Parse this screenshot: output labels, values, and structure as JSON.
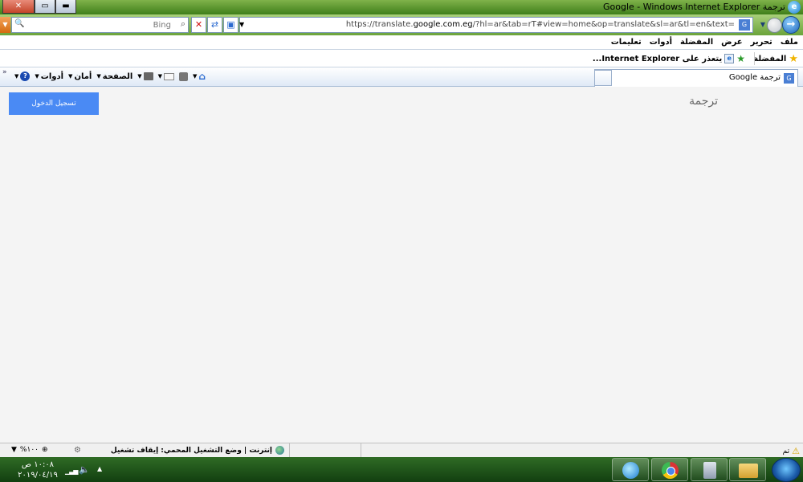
{
  "window": {
    "title": "ترجمة Google - Windows Internet Explorer",
    "buttons": {
      "minimize": "▬",
      "maximize": "▭",
      "close": "✕"
    }
  },
  "address_bar": {
    "url_prefix": "https://translate.",
    "url_domain": "google.com.eg",
    "url_suffix": "/?hl=ar&tab=rT#view=home&op=translate&sl=ar&tl=en&text=",
    "search_placeholder": "Bing"
  },
  "menu": [
    "ملف",
    "تحرير",
    "عرض",
    "المفضلة",
    "أدوات",
    "تعليمات"
  ],
  "favorites_bar": {
    "favorites_label": "المفضلة",
    "suggested_site": "يتعذر على Internet Explorer..."
  },
  "tab": {
    "title": "ترجمة Google"
  },
  "command_bar": {
    "page": "الصفحة",
    "safety": "أمان",
    "tools": "أدوات",
    "chevron": "»"
  },
  "content": {
    "signin_button": "تسجيل الدخول",
    "page_title": "ترجمة"
  },
  "status_bar": {
    "done": "تم",
    "zone": "إنترنت | وضع التشغيل المحمي: إيقاف تشغيل",
    "zoom": "%١٠٠"
  },
  "taskbar": {
    "time": "١٠:٠٨ ص",
    "date": "٢٠١٩/٠٤/١٩"
  },
  "icons": [
    "ie-logo-icon",
    "back-arrow-icon",
    "forward-arrow-icon",
    "stop-icon",
    "refresh-icon",
    "compat-view-icon",
    "search-icon",
    "star-icon",
    "add-favorite-icon",
    "home-icon",
    "feeds-icon",
    "mail-icon",
    "print-icon",
    "help-icon",
    "warning-icon",
    "globe-icon",
    "zoom-icon",
    "volume-icon",
    "network-icon",
    "start-orb-icon"
  ]
}
